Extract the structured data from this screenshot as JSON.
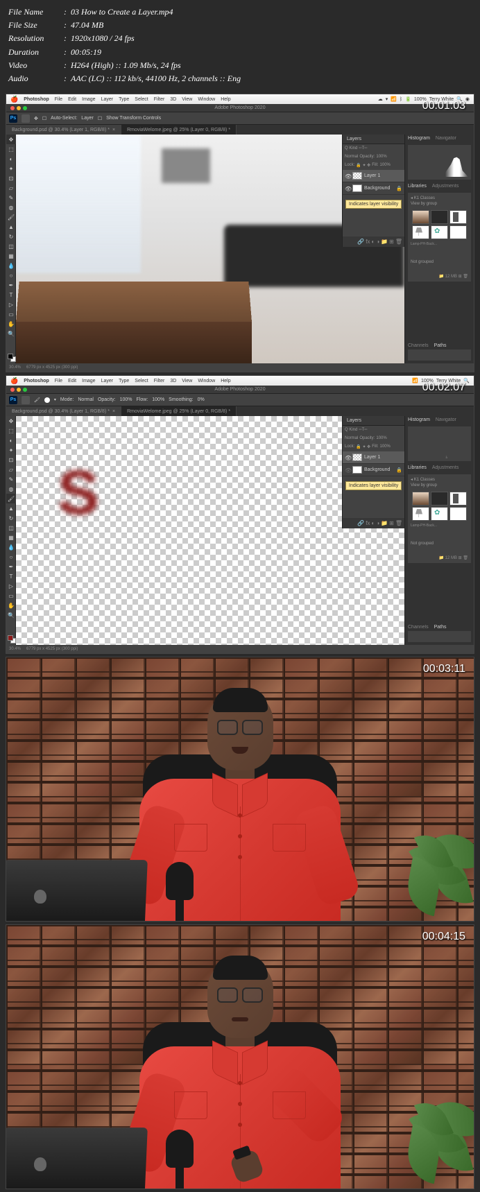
{
  "metadata": {
    "file_name_label": "File Name",
    "file_name": "03 How to Create a Layer.mp4",
    "file_size_label": "File Size",
    "file_size": "47.04 MB",
    "resolution_label": "Resolution",
    "resolution": "1920x1080 / 24 fps",
    "duration_label": "Duration",
    "duration": "00:05:19",
    "video_label": "Video",
    "video": "H264 (High) :: 1.09 Mb/s, 24 fps",
    "audio_label": "Audio",
    "audio": "AAC (LC) :: 112 kb/s, 44100 Hz, 2 channels :: Eng"
  },
  "timestamps": [
    "00:01:03",
    "00:02:07",
    "00:03:11",
    "00:04:15"
  ],
  "mac_menu": {
    "app": "Photoshop",
    "items": [
      "File",
      "Edit",
      "Image",
      "Layer",
      "Type",
      "Select",
      "Filter",
      "3D",
      "View",
      "Window",
      "Help"
    ],
    "battery": "100%",
    "user": "Terry White"
  },
  "window_title": "Adobe Photoshop 2020",
  "options_bar_1": {
    "auto_select": "Auto-Select:",
    "layer": "Layer",
    "show_transform": "Show Transform Controls"
  },
  "options_bar_2": {
    "mode": "Mode:",
    "normal": "Normal",
    "opacity_label": "Opacity:",
    "opacity": "100%",
    "flow_label": "Flow:",
    "flow": "100%",
    "smoothing_label": "Smoothing:",
    "smoothing": "0%"
  },
  "doc_tabs": {
    "tab1": "Background.psd @ 30.4% (Layer 1, RGB/8) *",
    "tab2": "RmoviaWelome.jpeg @ 25% (Layer 0, RGB/8) *"
  },
  "layers_panel": {
    "title": "Layers",
    "kind": "Q Kind",
    "blend": "Normal",
    "opacity_label": "Opacity:",
    "opacity": "100%",
    "lock": "Lock:",
    "fill_label": "Fill:",
    "fill": "100%",
    "layer1": "Layer 1",
    "background": "Background",
    "tooltip": "Indicates layer visibility"
  },
  "right_panels": {
    "histogram": "Histogram",
    "navigator": "Navigator",
    "libraries": "Libraries",
    "adjustments": "Adjustments",
    "classes": "K1 Classes",
    "view_by": "View by group",
    "not_grouped": "Not grouped",
    "lib_label": "Lamp-PH-Back...",
    "status": "12 MB",
    "channels": "Channels",
    "paths": "Paths"
  },
  "status_bar": {
    "zoom": "30.4%",
    "doc_info": "6779 px x 4525 px (300 ppi)"
  }
}
